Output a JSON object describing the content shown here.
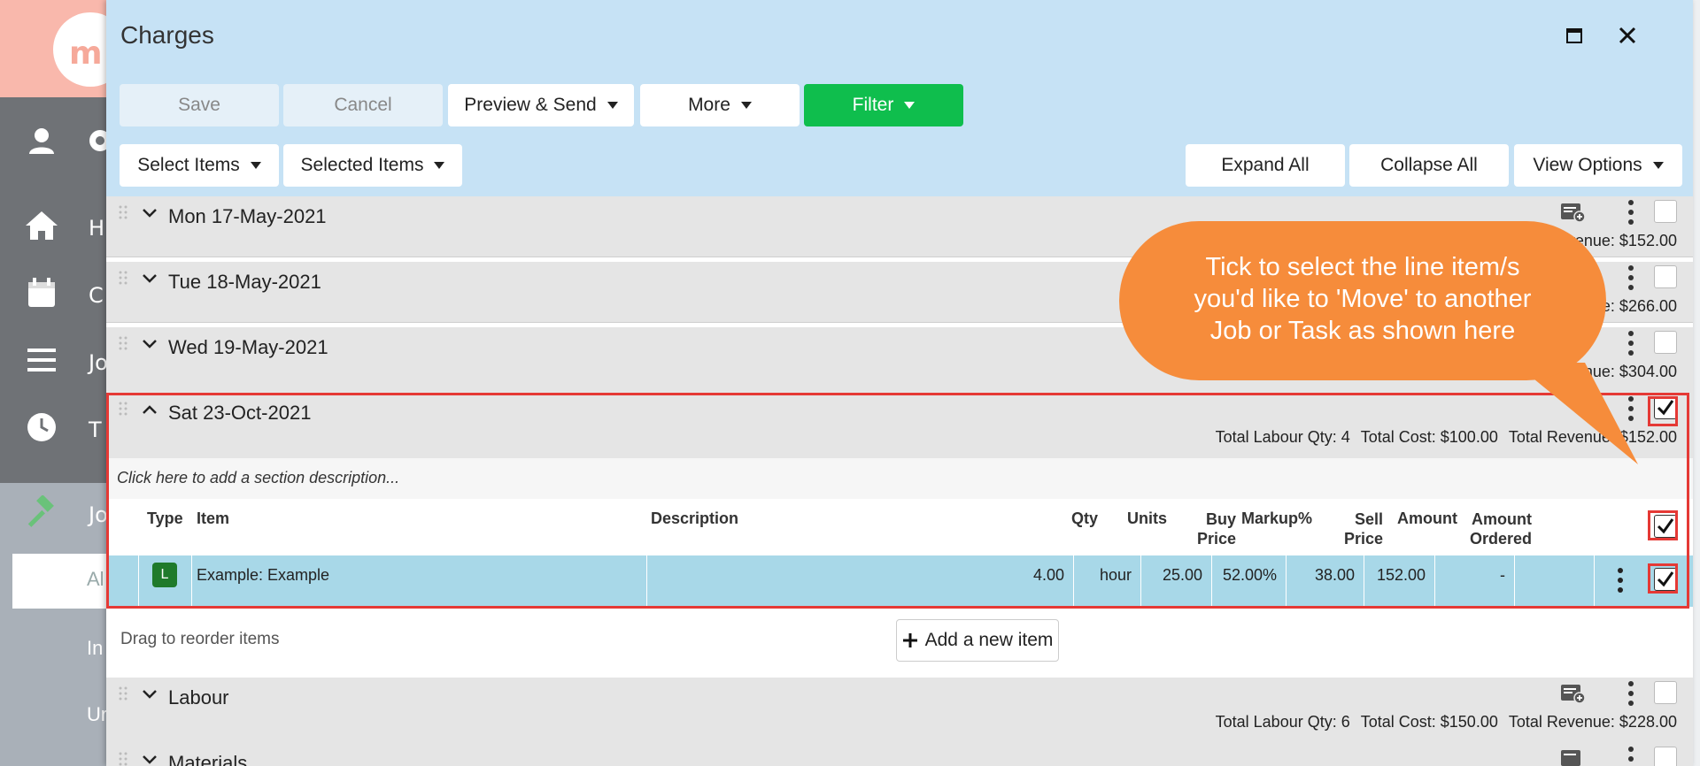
{
  "dialog": {
    "title": "Charges",
    "toolbar": {
      "save": "Save",
      "cancel": "Cancel",
      "preview_send": "Preview & Send",
      "more": "More",
      "filter": "Filter",
      "select_items": "Select Items",
      "selected_items": "Selected Items",
      "expand_all": "Expand All",
      "collapse_all": "Collapse All",
      "view_options": "View Options"
    }
  },
  "sections": [
    {
      "title": "Mon 17-May-2021",
      "revenue": "venue: $152.00",
      "checked": false
    },
    {
      "title": "Tue 18-May-2021",
      "revenue": "e: $266.00",
      "checked": false
    },
    {
      "title": "Wed 19-May-2021",
      "revenue": "venue: $304.00",
      "checked": false
    },
    {
      "title": "Sat 23-Oct-2021",
      "labour_qty": "Total Labour Qty: 4",
      "cost": "Total Cost: $100.00",
      "revenue": "Total Revenue: $152.00",
      "checked": true
    },
    {
      "title": "Labour",
      "labour_qty": "Total Labour Qty: 6",
      "cost": "Total Cost: $150.00",
      "revenue": "Total Revenue: $228.00",
      "checked": false
    },
    {
      "title": "Materials",
      "checked": false
    }
  ],
  "section_description_placeholder": "Click here to add a section description...",
  "table": {
    "headers": {
      "type": "Type",
      "item": "Item",
      "description": "Description",
      "qty": "Qty",
      "units": "Units",
      "buy_price_1": "Buy",
      "buy_price_2": "Price",
      "markup": "Markup%",
      "sell_price_1": "Sell",
      "sell_price_2": "Price",
      "amount": "Amount",
      "amount_ordered_1": "Amount",
      "amount_ordered_2": "Ordered"
    },
    "row": {
      "type": "L",
      "item": "Example: Example",
      "description": "",
      "qty": "4.00",
      "units": "hour",
      "buy_price": "25.00",
      "markup": "52.00%",
      "sell_price": "38.00",
      "amount": "152.00",
      "amount_ordered": "-"
    }
  },
  "drag_hint": "Drag to reorder items",
  "add_item": "Add a new item",
  "callout": {
    "line1": "Tick to select the line item/s",
    "line2": "you'd like to 'Move' to another",
    "line3": "Job or Task as shown here"
  },
  "sidebar": {
    "logo": "m",
    "items": [
      "H",
      "C",
      "Jo",
      "T",
      "Jo"
    ],
    "active_item": "Al",
    "sub_items": [
      "In",
      "Ur"
    ]
  },
  "colors": {
    "header_bg": "#c6e2f5",
    "filter_green": "#0fbe4d",
    "callout_orange": "#f68c3b",
    "highlight_red": "#e53935",
    "row_selected": "#a8d8e8"
  }
}
